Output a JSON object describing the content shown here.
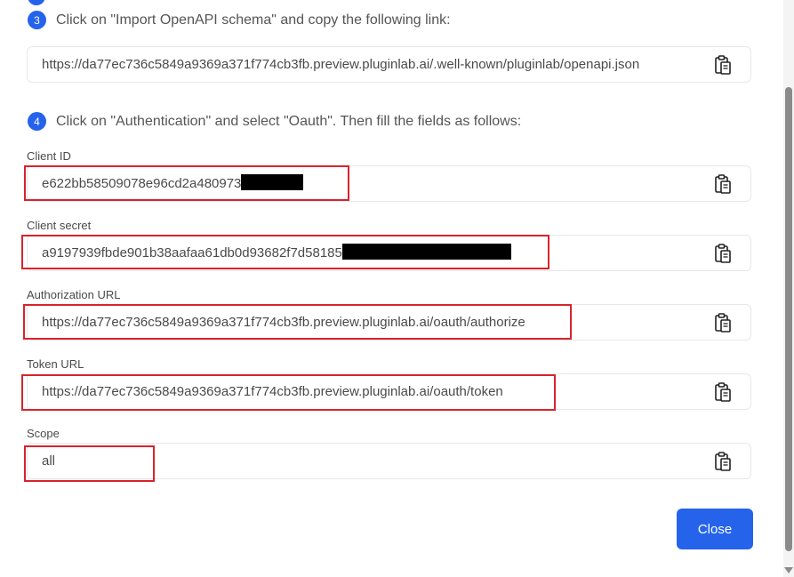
{
  "steps": {
    "step3": {
      "number": "3",
      "text": "Click on \"Import OpenAPI schema\" and copy the following link:"
    },
    "step4": {
      "number": "4",
      "text": "Click on \"Authentication\" and select \"Oauth\". Then fill the fields as follows:"
    }
  },
  "openapi_link": "https://da77ec736c5849a9369a371f774cb3fb.preview.pluginlab.ai/.well-known/pluginlab/openapi.json",
  "fields": {
    "client_id": {
      "label": "Client ID",
      "value": "e622bb58509078e96cd2a480973"
    },
    "client_secret": {
      "label": "Client secret",
      "value": "a9197939fbde901b38aafaa61db0d93682f7d58185"
    },
    "authorization_url": {
      "label": "Authorization URL",
      "value": "https://da77ec736c5849a9369a371f774cb3fb.preview.pluginlab.ai/oauth/authorize"
    },
    "token_url": {
      "label": "Token URL",
      "value": "https://da77ec736c5849a9369a371f774cb3fb.preview.pluginlab.ai/oauth/token"
    },
    "scope": {
      "label": "Scope",
      "value": "all"
    }
  },
  "close_label": "Close",
  "icons": {
    "copy": "clipboard-copy-icon"
  },
  "colors": {
    "accent": "#2563eb",
    "highlight": "#d9232d",
    "redaction": "#000000"
  }
}
